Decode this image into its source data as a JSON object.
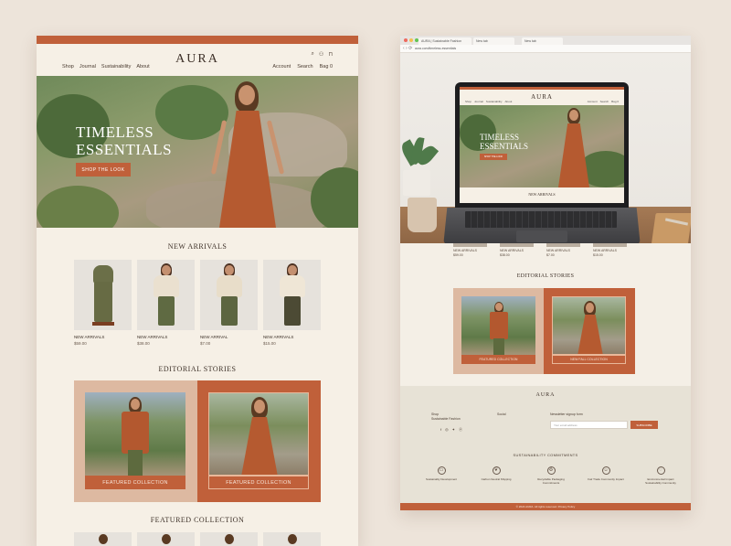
{
  "left": {
    "brand": "AURA",
    "nav_left": [
      "Shop",
      "Journal",
      "Sustainability",
      "About"
    ],
    "nav_right": [
      "Account",
      "Search",
      "Bag 0"
    ],
    "nav_icons": [
      "search-icon",
      "user-icon",
      "bag-icon"
    ],
    "hero": {
      "title_line1": "TIMELESS",
      "title_line2": "ESSENTIALS",
      "cta": "SHOP THE LOOK"
    },
    "new_arrivals_title": "NEW ARRIVALS",
    "products": [
      {
        "name": "NEW ARRIVALS",
        "price": "$59.00"
      },
      {
        "name": "NEW ARRIVALS",
        "price": "$38.00"
      },
      {
        "name": "NEW ARRIVAL",
        "price": "$7.00"
      },
      {
        "name": "NEW ARRIVALS",
        "price": "$15.00"
      }
    ],
    "editorial_title": "EDITORIAL STORIES",
    "editorial": [
      {
        "label": "FEATURED COLLECTION"
      },
      {
        "label": "FEATURED COLLECTION"
      }
    ],
    "featured_title": "FEATURED COLLECTION"
  },
  "right": {
    "tabs": [
      "AURA | Sustainable Fashion",
      "New tab",
      "New tab"
    ],
    "url": "aura.com/timeless-essentials",
    "screen": {
      "brand": "AURA",
      "nav_left": [
        "Shop",
        "Journal",
        "Sustainability",
        "About"
      ],
      "nav_right": [
        "Account",
        "Search",
        "Bag 0"
      ],
      "title_line1": "TIMELESS",
      "title_line2": "ESSENTIALS",
      "cta": "SHOP THE LOOK",
      "new_arrivals": "NEW ARRIVALS"
    },
    "thumbs": [
      {
        "name": "NEW ARRIVALS",
        "price": "$59.00"
      },
      {
        "name": "NEW ARRIVALS",
        "price": "$38.00"
      },
      {
        "name": "NEW ARRIVALS",
        "price": "$7.00"
      },
      {
        "name": "NEW ARRIVALS",
        "price": "$15.00"
      }
    ],
    "editorial_title": "EDITORIAL STORIES",
    "editorial": [
      {
        "label": "FEATURED COLLECTION"
      },
      {
        "label": "NEW FALL COLLECTION"
      }
    ],
    "footer": {
      "brand": "AURA",
      "shop_heading": "Shop",
      "shop_sub": "Sustainable Fashion",
      "social_heading": "Social",
      "social_icons": [
        "facebook-icon",
        "instagram-icon",
        "twitter-icon",
        "pinterest-icon"
      ],
      "newsletter_heading": "Newsletter signup form",
      "newsletter_placeholder": "Your email address",
      "newsletter_button": "SUBSCRIBE",
      "sustainability_title": "SUSTAINABILITY COMMITMENTS",
      "commitments": [
        {
          "icon": "package-icon",
          "text": "Sustainably Development"
        },
        {
          "icon": "leaf-icon",
          "text": "Carbon Neutral Shipping"
        },
        {
          "icon": "recycle-icon",
          "text": "Recyclable Packaging Commitments"
        },
        {
          "icon": "people-icon",
          "text": "Fair Trade Community Impact"
        },
        {
          "icon": "heart-icon",
          "text": "Environmental Impact Sustainability Community"
        }
      ],
      "copyright": "© 2024 AURA. All rights reserved. Privacy Policy"
    }
  },
  "colors": {
    "accent": "#c0603a",
    "background": "#ede4da",
    "page": "#f6f0e6",
    "editorial_light": "#ddb9a1"
  }
}
